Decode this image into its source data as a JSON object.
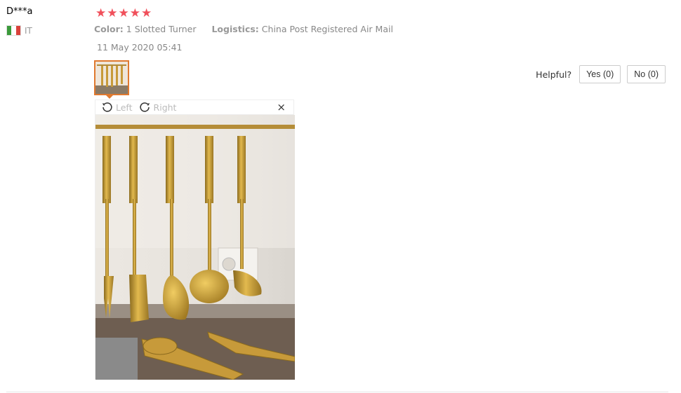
{
  "review": {
    "user": "D***a",
    "country": "IT",
    "rating": 5,
    "color_label": "Color:",
    "color_value": "1 Slotted Turner",
    "logistics_label": "Logistics:",
    "logistics_value": "China Post Registered Air Mail",
    "date": "11 May 2020 05:41"
  },
  "helpful": {
    "label": "Helpful?",
    "yes": "Yes (0)",
    "no": "No (0)"
  },
  "viewer": {
    "rotate_left": "Left",
    "rotate_right": "Right",
    "close": "×"
  },
  "colors": {
    "star": "#f0505b",
    "thumb_border": "#e0792f",
    "flag_green": "#3a9a3a",
    "flag_white": "#ffffff",
    "flag_red": "#d9413b"
  },
  "icons": [
    "rotate-left-icon",
    "rotate-right-icon",
    "close-icon",
    "star-icon",
    "italy-flag-icon"
  ]
}
